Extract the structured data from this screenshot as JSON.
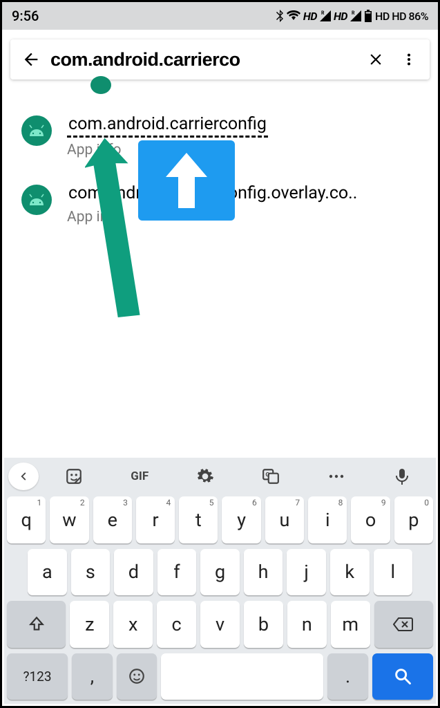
{
  "status": {
    "time": "9:56",
    "right_text": "HD   HD   86%"
  },
  "search": {
    "value": "com.android.carrierco"
  },
  "results": [
    {
      "title": "com.android.carrierconfig",
      "subtitle": "App info",
      "underlined": true
    },
    {
      "title": "com.android.carrierconfig.overlay.co..",
      "subtitle": "App info",
      "underlined": false
    }
  ],
  "keyboard": {
    "toolbar": [
      "sticker",
      "GIF",
      "settings",
      "translate",
      "more",
      "mic"
    ],
    "row1": [
      {
        "k": "q",
        "s": "1"
      },
      {
        "k": "w",
        "s": "2"
      },
      {
        "k": "e",
        "s": "3"
      },
      {
        "k": "r",
        "s": "4"
      },
      {
        "k": "t",
        "s": "5"
      },
      {
        "k": "y",
        "s": "6"
      },
      {
        "k": "u",
        "s": "7"
      },
      {
        "k": "i",
        "s": "8"
      },
      {
        "k": "o",
        "s": "9"
      },
      {
        "k": "p",
        "s": "0"
      }
    ],
    "row2": [
      "a",
      "s",
      "d",
      "f",
      "g",
      "h",
      "j",
      "k",
      "l"
    ],
    "row3": [
      "z",
      "x",
      "c",
      "v",
      "b",
      "n",
      "m"
    ],
    "row4": {
      "numkey": "?123",
      "comma": ",",
      "period": "."
    }
  }
}
